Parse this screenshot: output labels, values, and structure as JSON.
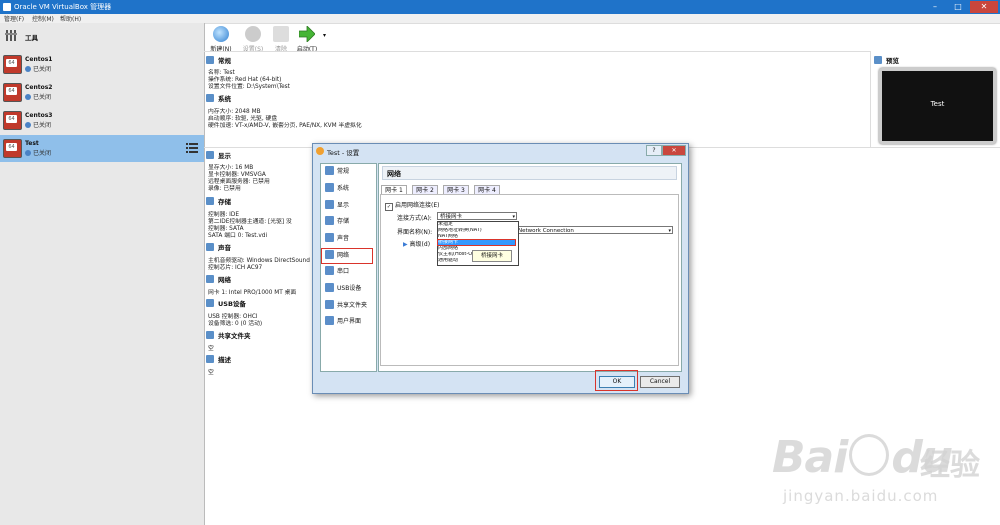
{
  "window": {
    "title": "Oracle VM VirtualBox 管理器",
    "controls": [
      "–",
      "□",
      "✕"
    ]
  },
  "menu": [
    "管理(F)",
    "控制(M)",
    "帮助(H)"
  ],
  "tools_label": "工具",
  "vms": [
    {
      "name": "Centos1",
      "state": "已关闭"
    },
    {
      "name": "Centos2",
      "state": "已关闭"
    },
    {
      "name": "Centos3",
      "state": "已关闭"
    },
    {
      "name": "Test",
      "state": "已关闭"
    }
  ],
  "toolbar": {
    "new": "新建(N)",
    "settings": "设置(S)",
    "discard": "清除",
    "start": "启动(T)"
  },
  "details": {
    "general": {
      "title": "常规",
      "lines": [
        "名称:          Test",
        "操作系统:      Red Hat (64-bit)",
        "设置文件位置:  D:\\System\\Test"
      ]
    },
    "system": {
      "title": "系统",
      "lines": [
        "内存大小:    2048 MB",
        "启动顺序:    软驱, 光驱, 硬盘",
        "硬件加速:    VT-x/AMD-V, 嵌套分页, PAE/NX, KVM 半虚拟化"
      ]
    },
    "display": {
      "title": "显示",
      "lines": [
        "显存大小:          16 MB",
        "显卡控制器:        VMSVGA",
        "远程桌面服务器:    已禁用",
        "录像:              已禁用"
      ]
    },
    "storage": {
      "title": "存储",
      "lines": [
        "控制器: IDE",
        "  第二IDE控制器主通道:  [光驱] 没",
        "控制器: SATA",
        "SATA 端口 0:         Test.vdi"
      ]
    },
    "audio": {
      "title": "声音",
      "lines": [
        "主机音频驱动:  Windows DirectSound",
        "控制芯片:      ICH AC97"
      ]
    },
    "network": {
      "title": "网络",
      "lines": [
        "网卡 1:  Intel PRO/1000 MT 桌面"
      ]
    },
    "usb": {
      "title": "USB设备",
      "lines": [
        "USB 控制器:  OHCI",
        "设备筛选:    0 (0 活动)"
      ]
    },
    "shared": {
      "title": "共享文件夹",
      "lines": [
        "空"
      ]
    },
    "desc": {
      "title": "描述",
      "lines": [
        "空"
      ]
    }
  },
  "preview": {
    "title": "预览",
    "screen_text": "Test"
  },
  "dialog": {
    "title": "Test - 设置",
    "nav": [
      "常规",
      "系统",
      "显示",
      "存储",
      "声音",
      "网络",
      "串口",
      "USB设备",
      "共享文件夹",
      "用户界面"
    ],
    "active_nav": "网络",
    "heading": "网络",
    "tabs": [
      "网卡 1",
      "网卡 2",
      "网卡 3",
      "网卡 4"
    ],
    "enable_label": "启用网络连接(E)",
    "attach_label": "连接方式(A):",
    "attach_value": "桥接网卡",
    "name_label": "界面名称(N):",
    "name_value": "Network Connection",
    "advanced_label": "高级(d)",
    "dropdown_options": [
      "未指定",
      "网络地址转换(NAT)",
      "NAT网络",
      "桥接网卡",
      "内部网络",
      "仅主机(Host-Only)网络",
      "通用驱动"
    ],
    "dropdown_highlight": "桥接网卡",
    "tooltip": "桥接网卡",
    "ok": "OK",
    "cancel": "Cancel"
  },
  "watermark": {
    "brand": "Bai",
    "brand2": "du",
    "cn": "经验",
    "url": "jingyan.baidu.com"
  },
  "colors": {
    "titlebar": "#1f73c9",
    "selection": "#8fbfea",
    "highlight": "#d9342b"
  }
}
